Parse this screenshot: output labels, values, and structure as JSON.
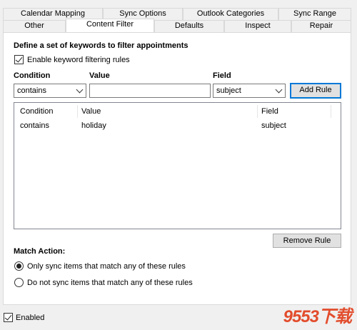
{
  "tabs_row1": [
    {
      "label": "Calendar Mapping"
    },
    {
      "label": "Sync Options"
    },
    {
      "label": "Outlook Categories"
    },
    {
      "label": "Sync Range"
    }
  ],
  "tabs_row2": [
    {
      "label": "Other"
    },
    {
      "label": "Content Filter",
      "active": true
    },
    {
      "label": "Defaults"
    },
    {
      "label": "Inspect"
    },
    {
      "label": "Repair"
    }
  ],
  "filter": {
    "heading": "Define a set of keywords to filter appointments",
    "enable_label": "Enable keyword filtering rules",
    "enable_checked": true,
    "condition_label": "Condition",
    "value_label": "Value",
    "field_label": "Field",
    "condition_selected": "contains",
    "value_input": "",
    "field_selected": "subject",
    "add_rule": "Add Rule",
    "remove_rule": "Remove Rule"
  },
  "rules_table": {
    "columns": [
      "Condition",
      "Value",
      "Field"
    ],
    "rows": [
      {
        "condition": "contains",
        "value": "holiday",
        "field": "subject"
      }
    ]
  },
  "match_action": {
    "label": "Match Action:",
    "options": [
      {
        "label": "Only sync items that match any of these rules",
        "selected": true
      },
      {
        "label": "Do not sync items that match any of these rules",
        "selected": false
      }
    ]
  },
  "footer": {
    "enabled_label": "Enabled",
    "enabled_checked": true
  },
  "watermark": "9553下载"
}
